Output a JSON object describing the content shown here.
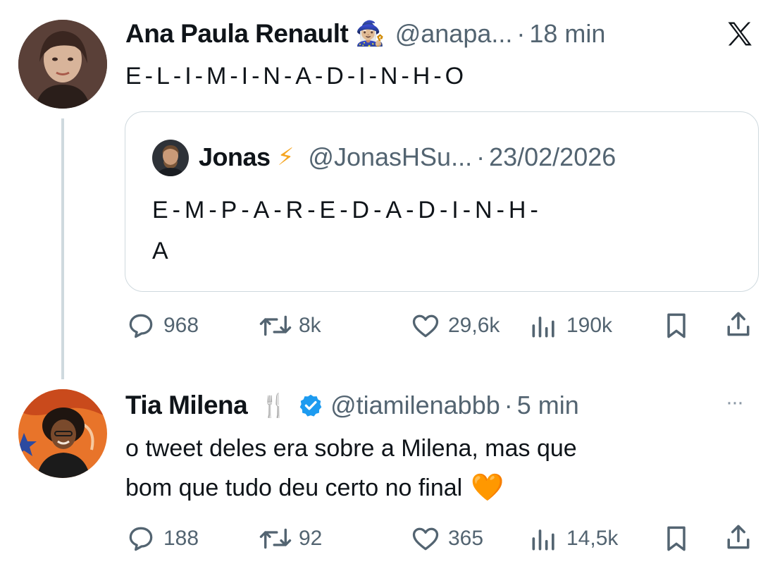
{
  "tweet1": {
    "display_name": "Ana Paula Renault",
    "name_emoji": "🧙🏼‍♀️",
    "handle": "@anapa...",
    "dot": "·",
    "time": "18 min",
    "text": "E-L-I-M-I-N-A-D-I-N-H-O",
    "close_label": "𝕏",
    "quote": {
      "display_name": "Jonas",
      "name_emoji": "⚡",
      "handle": "@JonasHSu...",
      "dot": "·",
      "date": "23/02/2026",
      "text_line1": "E-M-P-A-R-E-D-A-D-I-N-H-",
      "text_line2": "A"
    },
    "stats": {
      "replies": "968",
      "retweets": "8k",
      "likes": "29,6k",
      "views": "190k"
    }
  },
  "tweet2": {
    "display_name": "Tia Milena",
    "name_emoji": "🍴",
    "handle": "@tiamilenabbb",
    "dot": "·",
    "time": "5 min",
    "more_label": "···",
    "text_line1": "o tweet deles era sobre a Milena, mas que",
    "text_line2": "bom que tudo deu certo no final",
    "text_emoji": "🧡",
    "stats": {
      "replies": "188",
      "retweets": "92",
      "likes": "365",
      "views": "14,5k"
    }
  },
  "colors": {
    "verified": "#1d9bf0",
    "muted": "#536471",
    "text": "#0f1419",
    "border": "#cfd9de"
  },
  "icons": [
    "reply-icon",
    "retweet-icon",
    "like-icon",
    "views-icon",
    "bookmark-icon",
    "share-icon",
    "verified-badge-icon",
    "x-logo-icon",
    "more-icon"
  ]
}
